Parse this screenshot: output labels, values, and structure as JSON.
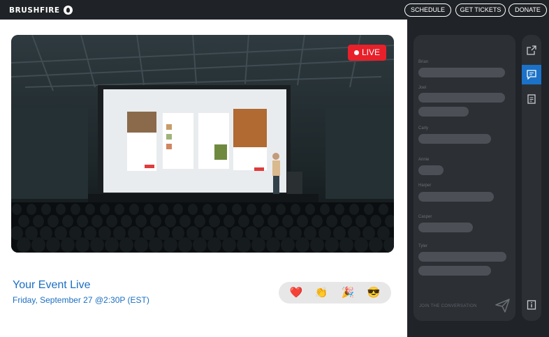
{
  "header": {
    "brand": "BRUSHFIRE",
    "nav": [
      "SCHEDULE",
      "GET TICKETS",
      "DONATE"
    ]
  },
  "video": {
    "live_label": "LIVE"
  },
  "event": {
    "title": "Your Event Live",
    "datetime": "Friday, September 27 @2:30P (EST)"
  },
  "reactions": [
    "❤️",
    "👏",
    "🎉",
    "😎"
  ],
  "chat": {
    "messages": [
      {
        "name": "Brian"
      },
      {
        "name": "Joel"
      },
      {
        "name": "Carly"
      },
      {
        "name": "Annie"
      },
      {
        "name": "Harper"
      },
      {
        "name": "Casper"
      },
      {
        "name": "Tyler"
      }
    ],
    "input_placeholder": "JOIN THE CONVERSATION"
  },
  "rail": {
    "icons": [
      "share-icon",
      "chat-icon",
      "notes-icon",
      "info-icon"
    ],
    "active": "chat-icon"
  },
  "colors": {
    "accent": "#1b72c8",
    "live": "#e8202a",
    "title": "#1b6fc2",
    "panel": "#202327"
  }
}
